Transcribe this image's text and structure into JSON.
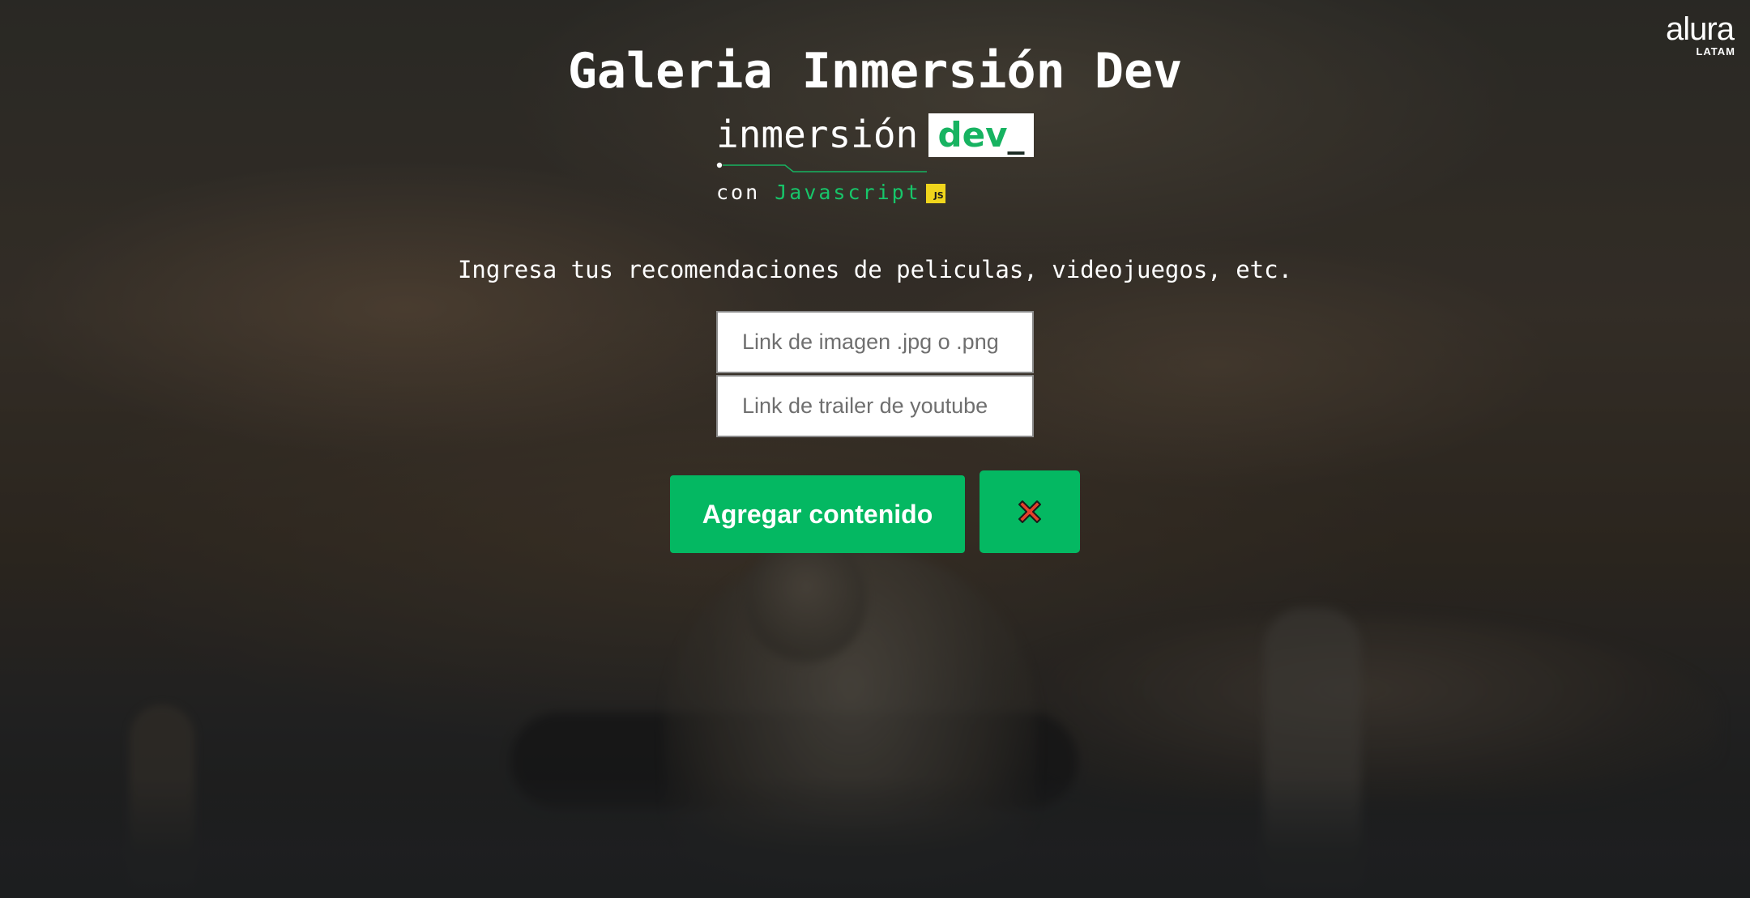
{
  "header": {
    "title": "Galeria Inmersión Dev",
    "logo_word": "alura",
    "logo_sub": "LATAM"
  },
  "brand": {
    "word": "inmersión",
    "box_text": "dev",
    "box_cursor": "_",
    "sub_prefix": "con",
    "sub_language": "Javascript",
    "badge": "JS"
  },
  "main": {
    "subtitle": "Ingresa tus recomendaciones de peliculas, videojuegos, etc.",
    "image_input": {
      "placeholder": "Link de imagen .jpg o .png",
      "value": ""
    },
    "trailer_input": {
      "placeholder": "Link de trailer de youtube",
      "value": ""
    },
    "add_button_label": "Agregar contenido",
    "clear_button_icon": "close-x-icon"
  },
  "colors": {
    "accent_green": "#04b862",
    "brand_green": "#17c66a",
    "js_yellow": "#f0d51c",
    "close_red": "#e5402a"
  }
}
